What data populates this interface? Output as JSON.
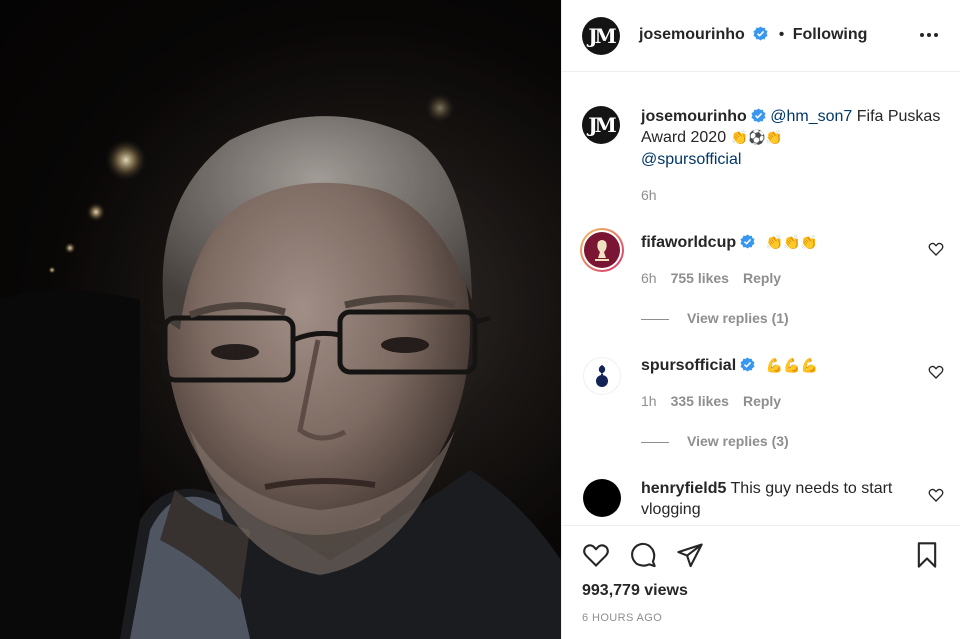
{
  "post": {
    "owner": "josemourinho",
    "follow_dot": "•",
    "follow_status": "Following",
    "caption": {
      "author": "josemourinho",
      "mention_1": "@hm_son7",
      "text": " Fifa Puskas Award 2020 ",
      "emoji": "👏⚽👏",
      "mention_2": "@spursofficial",
      "time": "6h"
    },
    "comments": [
      {
        "user": "fifaworldcup",
        "verified": true,
        "text": "👏👏👏",
        "time": "6h",
        "likes": "755 likes",
        "reply_label": "Reply",
        "view_replies": "View replies (1)"
      },
      {
        "user": "spursofficial",
        "verified": true,
        "text": "💪💪💪",
        "time": "1h",
        "likes": "335 likes",
        "reply_label": "Reply",
        "view_replies": "View replies (3)"
      },
      {
        "user": "henryfield5",
        "verified": false,
        "text": " This guy needs to start vlogging"
      }
    ],
    "views": "993,779 views",
    "posted_ago": "6 HOURS AGO"
  },
  "icons": {
    "heart": "heart-icon",
    "comment": "comment-icon",
    "share": "paper-plane-icon",
    "save": "bookmark-icon",
    "more": "more-options-icon",
    "verified": "verified-badge-icon"
  },
  "colors": {
    "verified": "#3897f0",
    "mention": "#00376b",
    "secondary_text": "#8e8e8e",
    "border": "#efefef"
  }
}
